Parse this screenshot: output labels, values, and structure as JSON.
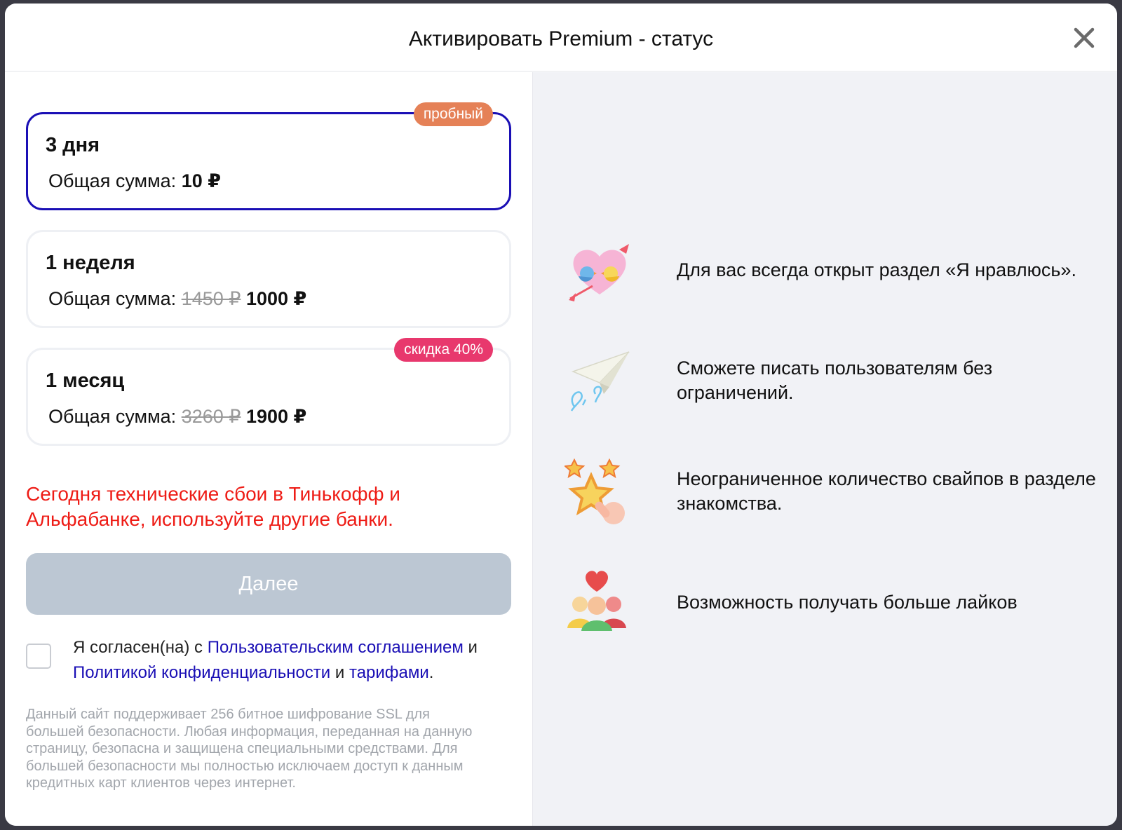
{
  "header": {
    "title": "Активировать Premium - статус"
  },
  "plans": [
    {
      "name": "3 дня",
      "sum_label": "Общая сумма:",
      "old_price": "",
      "price": "10 ₽",
      "badge": "пробный",
      "selected": true
    },
    {
      "name": "1 неделя",
      "sum_label": "Общая сумма:",
      "old_price": "1450 ₽",
      "price": "1000 ₽",
      "badge": "",
      "selected": false
    },
    {
      "name": "1 месяц",
      "sum_label": "Общая сумма:",
      "old_price": "3260 ₽",
      "price": "1900 ₽",
      "badge": "скидка 40%",
      "selected": false
    }
  ],
  "warning": "Сегодня технические сбои в Тинькофф и Альфабанке, используйте другие банки.",
  "next_button": "Далее",
  "agreement": {
    "prefix": "Я согласен(на) с",
    "link1": "Пользовательским соглашением",
    "and1": "и",
    "link2": "Политикой конфиденциальности",
    "and2": "и",
    "link3": "тарифами",
    "suffix": "."
  },
  "ssl_note": "Данный сайт поддерживает 256 битное шифрование SSL для большей безопасности. Любая информация, переданная на данную страницу, безопасна и защищена специальными средствами. Для большей безопасности мы полностью исключаем доступ к данным кредитных карт клиентов через интернет.",
  "features": [
    {
      "icon": "love-birds-heart-icon",
      "text": "Для вас всегда открыт раздел «Я нравлюсь»."
    },
    {
      "icon": "paper-plane-icon",
      "text": "Сможете писать пользователям без ограничений."
    },
    {
      "icon": "stars-swipe-icon",
      "text": "Неограниченное количество свайпов в разделе знакомства."
    },
    {
      "icon": "people-heart-icon",
      "text": "Возможность получать больше лайков"
    }
  ],
  "colors": {
    "accent": "#1a0fb5",
    "warning": "#ee1c16",
    "badge_trial": "#e58157",
    "badge_sale": "#e8386d",
    "button_disabled": "#bcc7d3"
  }
}
